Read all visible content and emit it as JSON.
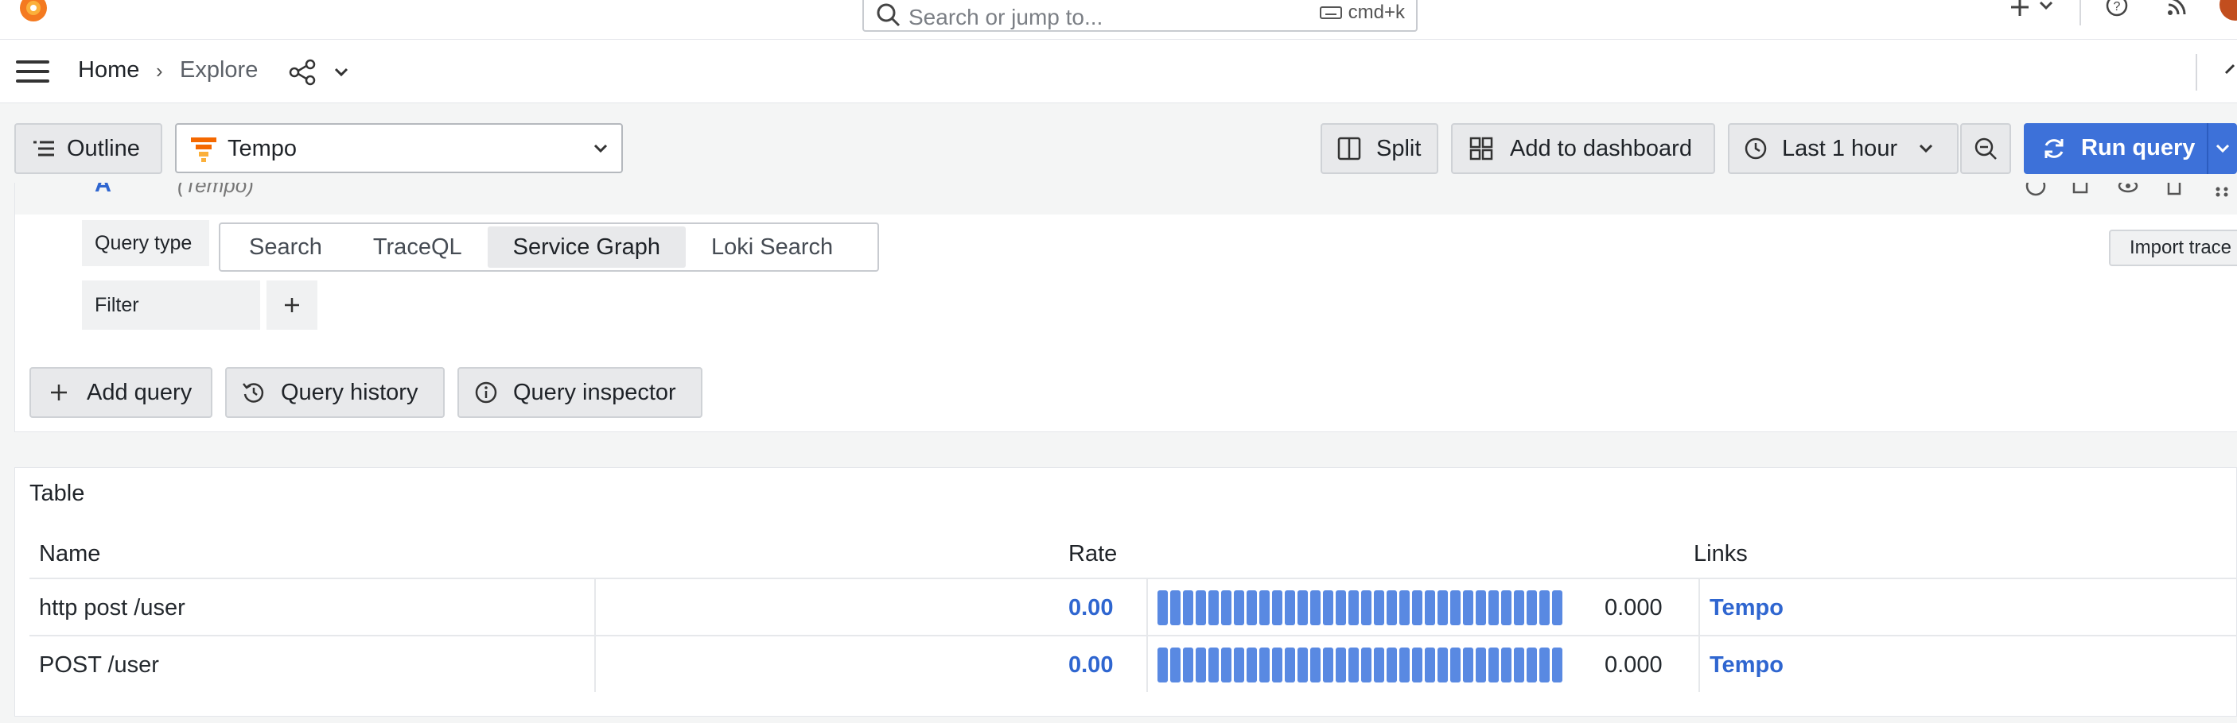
{
  "topbar": {
    "search_placeholder": "Search or jump to...",
    "shortcut": "cmd+k"
  },
  "breadcrumb": {
    "home": "Home",
    "current": "Explore"
  },
  "toolbar": {
    "outline_label": "Outline",
    "datasource": "Tempo",
    "split_label": "Split",
    "add_to_dashboard_label": "Add to dashboard",
    "time_range": "Last 1 hour",
    "run_query_label": "Run query"
  },
  "query": {
    "ref_id": "A",
    "datasource_hint": "(Tempo)",
    "query_type_label": "Query type",
    "query_types": [
      "Search",
      "TraceQL",
      "Service Graph",
      "Loki Search"
    ],
    "selected_query_type": "Service Graph",
    "filter_label": "Filter",
    "import_trace_label": "Import trace"
  },
  "actions": {
    "add_query": "Add query",
    "query_history": "Query history",
    "query_inspector": "Query inspector"
  },
  "table": {
    "title": "Table",
    "columns": [
      "Name",
      "Rate",
      "Links"
    ],
    "rows": [
      {
        "name": "http post /user",
        "rate": "0.00",
        "gauge_value": "0.000",
        "link": "Tempo"
      },
      {
        "name": "POST /user",
        "rate": "0.00",
        "gauge_value": "0.000",
        "link": "Tempo"
      }
    ]
  },
  "colors": {
    "primary": "#3d71d9",
    "link": "#2f66d0",
    "gauge": "#4b7fdf",
    "brand_orange": "#f46800"
  }
}
